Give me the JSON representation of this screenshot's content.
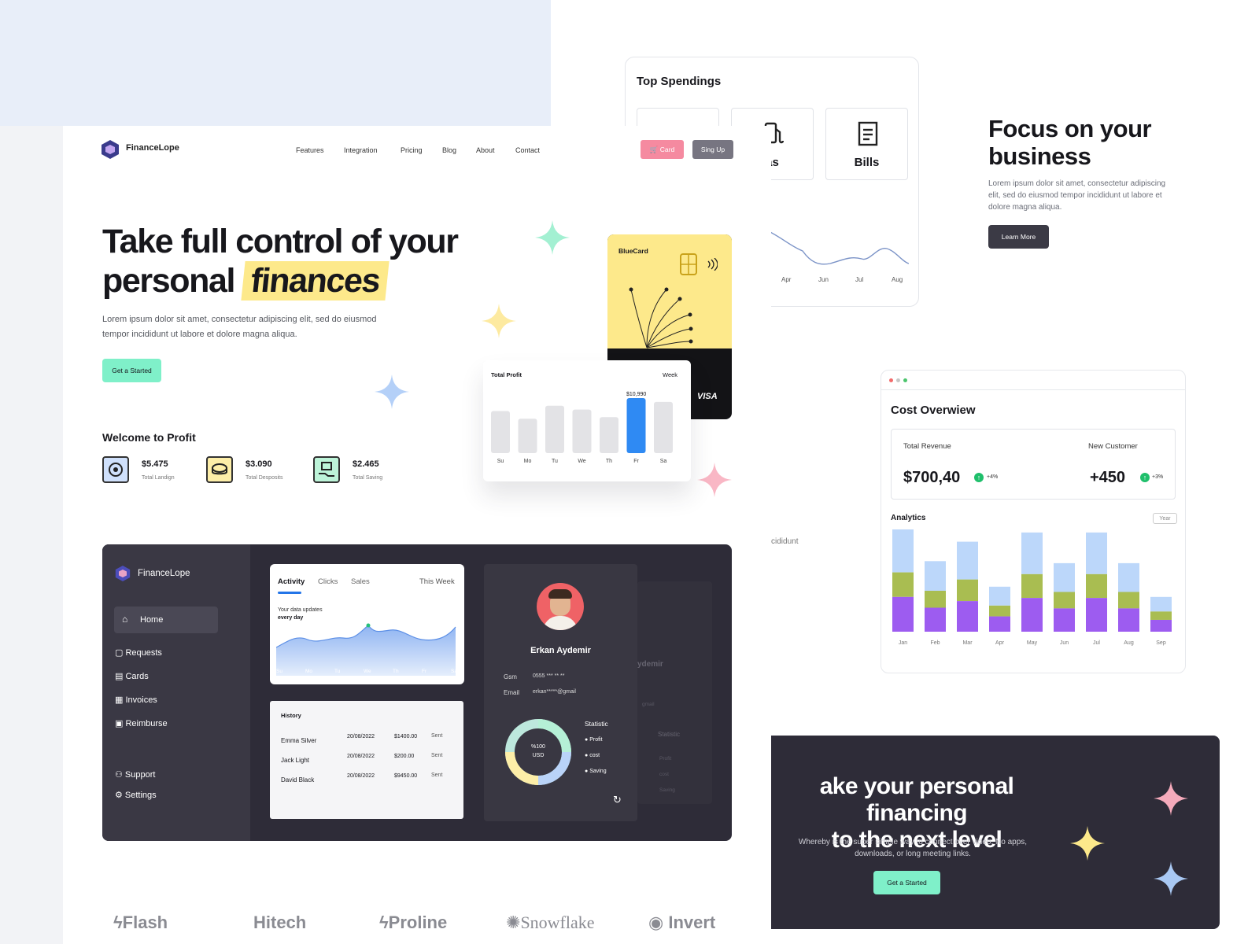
{
  "app": {
    "name": "FinanceLope"
  },
  "nav": {
    "items": [
      "Features",
      "Integration",
      "Pricing",
      "Blog",
      "About",
      "Contact"
    ],
    "card_label": "Card",
    "signup_label": "Sing Up"
  },
  "hero": {
    "title_line1": "Take full control of your",
    "title_line2a": "personal",
    "title_line2b": "finances",
    "body": "Lorem ipsum dolor sit amet, consectetur adipiscing elit, sed do eiusmod tempor incididunt ut labore et dolore magna aliqua.",
    "cta": "Get a Started"
  },
  "welcome": {
    "title": "Welcome to Profit",
    "stats": [
      {
        "value": "$5.475",
        "label": "Total Landign",
        "color": "#cfe0fb",
        "icon": "eye-icon"
      },
      {
        "value": "$3.090",
        "label": "Total Desposits",
        "color": "#fdeea8",
        "icon": "coins-icon"
      },
      {
        "value": "$2.465",
        "label": "Total Saving",
        "color": "#bdf4d9",
        "icon": "hand-money-icon"
      }
    ]
  },
  "bluecard": {
    "title": "BlueCard",
    "brand": "VISA"
  },
  "profit": {
    "title": "Total Profit",
    "period": "Week",
    "peak_label": "$10,990",
    "days": [
      "Su",
      "Mo",
      "Tu",
      "We",
      "Th",
      "Fr",
      "Sa"
    ],
    "values": [
      0.55,
      0.45,
      0.62,
      0.57,
      0.47,
      0.72,
      0.67
    ]
  },
  "spendings": {
    "title": "Top Spendings",
    "tiles": [
      "",
      "as",
      "Bills"
    ],
    "months": [
      "Apr",
      "Jun",
      "Jul",
      "Aug"
    ]
  },
  "focus": {
    "title": "Focus on your business",
    "body": "Lorem ipsum dolor sit amet, consectetur adipiscing elit, sed do eiusmod tempor incididunt ut labore et dolore magna aliqua.",
    "button": "Learn More"
  },
  "cost": {
    "title": "Cost Overwiew",
    "revenue_label": "Total Revenue",
    "revenue_value": "$700,40",
    "revenue_pct": "+4%",
    "customer_label": "New Customer",
    "customer_value": "+450",
    "customer_pct": "+3%",
    "analytics_label": "Analytics",
    "period": "Year",
    "months": [
      "Jan",
      "Feb",
      "Mar",
      "Apr",
      "May",
      "Jun",
      "Jul",
      "Aug",
      "Sep"
    ],
    "totals": [
      1.0,
      0.69,
      0.88,
      0.44,
      0.97,
      0.67,
      0.97,
      0.67,
      0.34
    ]
  },
  "fragment": {
    "text": "cididunt"
  },
  "cta": {
    "title_line1": "ake your personal financing",
    "title_line2": "to the next level",
    "body": "Whereby is the super simple way to connect over video. No apps, downloads, or long meeting links.",
    "button": "Get a Started"
  },
  "dashboard": {
    "brand": "FinanceLope",
    "menu": [
      "Home",
      "Requests",
      "Cards",
      "Invoices",
      "Reimburse"
    ],
    "footer_menu": [
      "Support",
      "Settings"
    ],
    "tabs": [
      "Activity",
      "Clicks",
      "Sales"
    ],
    "period": "This Week",
    "subtitle_a": "Your data updates",
    "subtitle_b": "every day",
    "days": [
      "Su",
      "Mo",
      "Tu",
      "We",
      "Th",
      "Fr",
      "Sa"
    ],
    "history_title": "History",
    "history": [
      {
        "name": "Emma Silver",
        "date": "20/08/2022",
        "amount": "$1400.00",
        "status": "Sent"
      },
      {
        "name": "Jack Light",
        "date": "20/08/2022",
        "amount": "$200.00",
        "status": "Sent"
      },
      {
        "name": "David Black",
        "date": "20/08/2022",
        "amount": "$9450.00",
        "status": "Sent"
      }
    ],
    "profile": {
      "name": "Erkan Aydemir",
      "gsm_label": "Gsm",
      "gsm": "0555 *** ** **",
      "email_label": "Email",
      "email": "erkan*****@gmail",
      "statistic": "Statistic",
      "donut_a": "%100",
      "donut_b": "USD",
      "legend": [
        "Profit",
        "cost",
        "Saving"
      ]
    },
    "ghost": {
      "name": "ydemir",
      "stat": "Statistic",
      "legend": [
        "Profit",
        "cost",
        "Saving"
      ],
      "email": "gmail"
    }
  },
  "brands": [
    "Flash",
    "Hitech",
    "Proline",
    "Snowflake",
    "Invert"
  ]
}
